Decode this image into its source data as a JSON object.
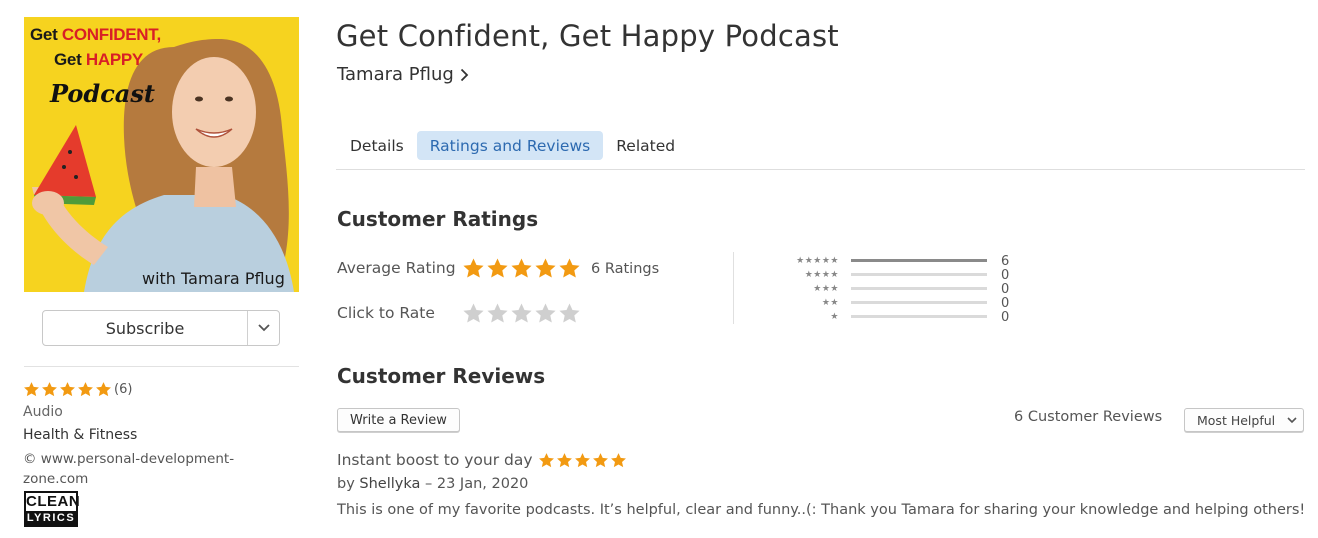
{
  "artwork": {
    "title_part1": "Get ",
    "title_part1_red": "CONFIDENT,",
    "title_part2": "Get ",
    "title_part2_red": "HAPPY",
    "title_part3": "Podcast",
    "credit": "with Tamara Pflug"
  },
  "sidebar": {
    "subscribe_label": "Subscribe",
    "rating_stars": 5,
    "rating_count": "(6)",
    "genre": "Audio",
    "category": "Health & Fitness",
    "copyright": "© www.personal-development-zone.com",
    "badge_top": "CLEAN",
    "badge_bottom": "LYRICS"
  },
  "header": {
    "title": "Get Confident, Get Happy Podcast",
    "artist": "Tamara Pflug"
  },
  "tabs": [
    {
      "label": "Details",
      "active": false
    },
    {
      "label": "Ratings and Reviews",
      "active": true
    },
    {
      "label": "Related",
      "active": false
    }
  ],
  "ratings": {
    "heading": "Customer Ratings",
    "average_label": "Average Rating",
    "average_stars": 5,
    "average_count": "6 Ratings",
    "click_label": "Click to Rate",
    "histogram": [
      {
        "stars": 5,
        "count": "6",
        "fraction": 1.0
      },
      {
        "stars": 4,
        "count": "0",
        "fraction": 0
      },
      {
        "stars": 3,
        "count": "0",
        "fraction": 0
      },
      {
        "stars": 2,
        "count": "0",
        "fraction": 0
      },
      {
        "stars": 1,
        "count": "0",
        "fraction": 0
      }
    ]
  },
  "reviews": {
    "heading": "Customer Reviews",
    "write_label": "Write a Review",
    "total": "6 Customer Reviews",
    "sort_value": "Most Helpful",
    "items": [
      {
        "title": "Instant boost to your day",
        "stars": 5,
        "by_prefix": "by ",
        "author": "Shellyka",
        "date": " – 23 Jan, 2020",
        "body": "This is one of my favorite podcasts. It’s helpful, clear and funny..(: Thank you Tamara for sharing your knowledge and helping others!"
      }
    ]
  },
  "colors": {
    "star_orange": "#f29a12",
    "star_empty": "#cfcfcf",
    "tab_active_bg": "#d3e5f6",
    "tab_active_text": "#2d6ab0",
    "artwork_bg": "#f6d31f"
  }
}
